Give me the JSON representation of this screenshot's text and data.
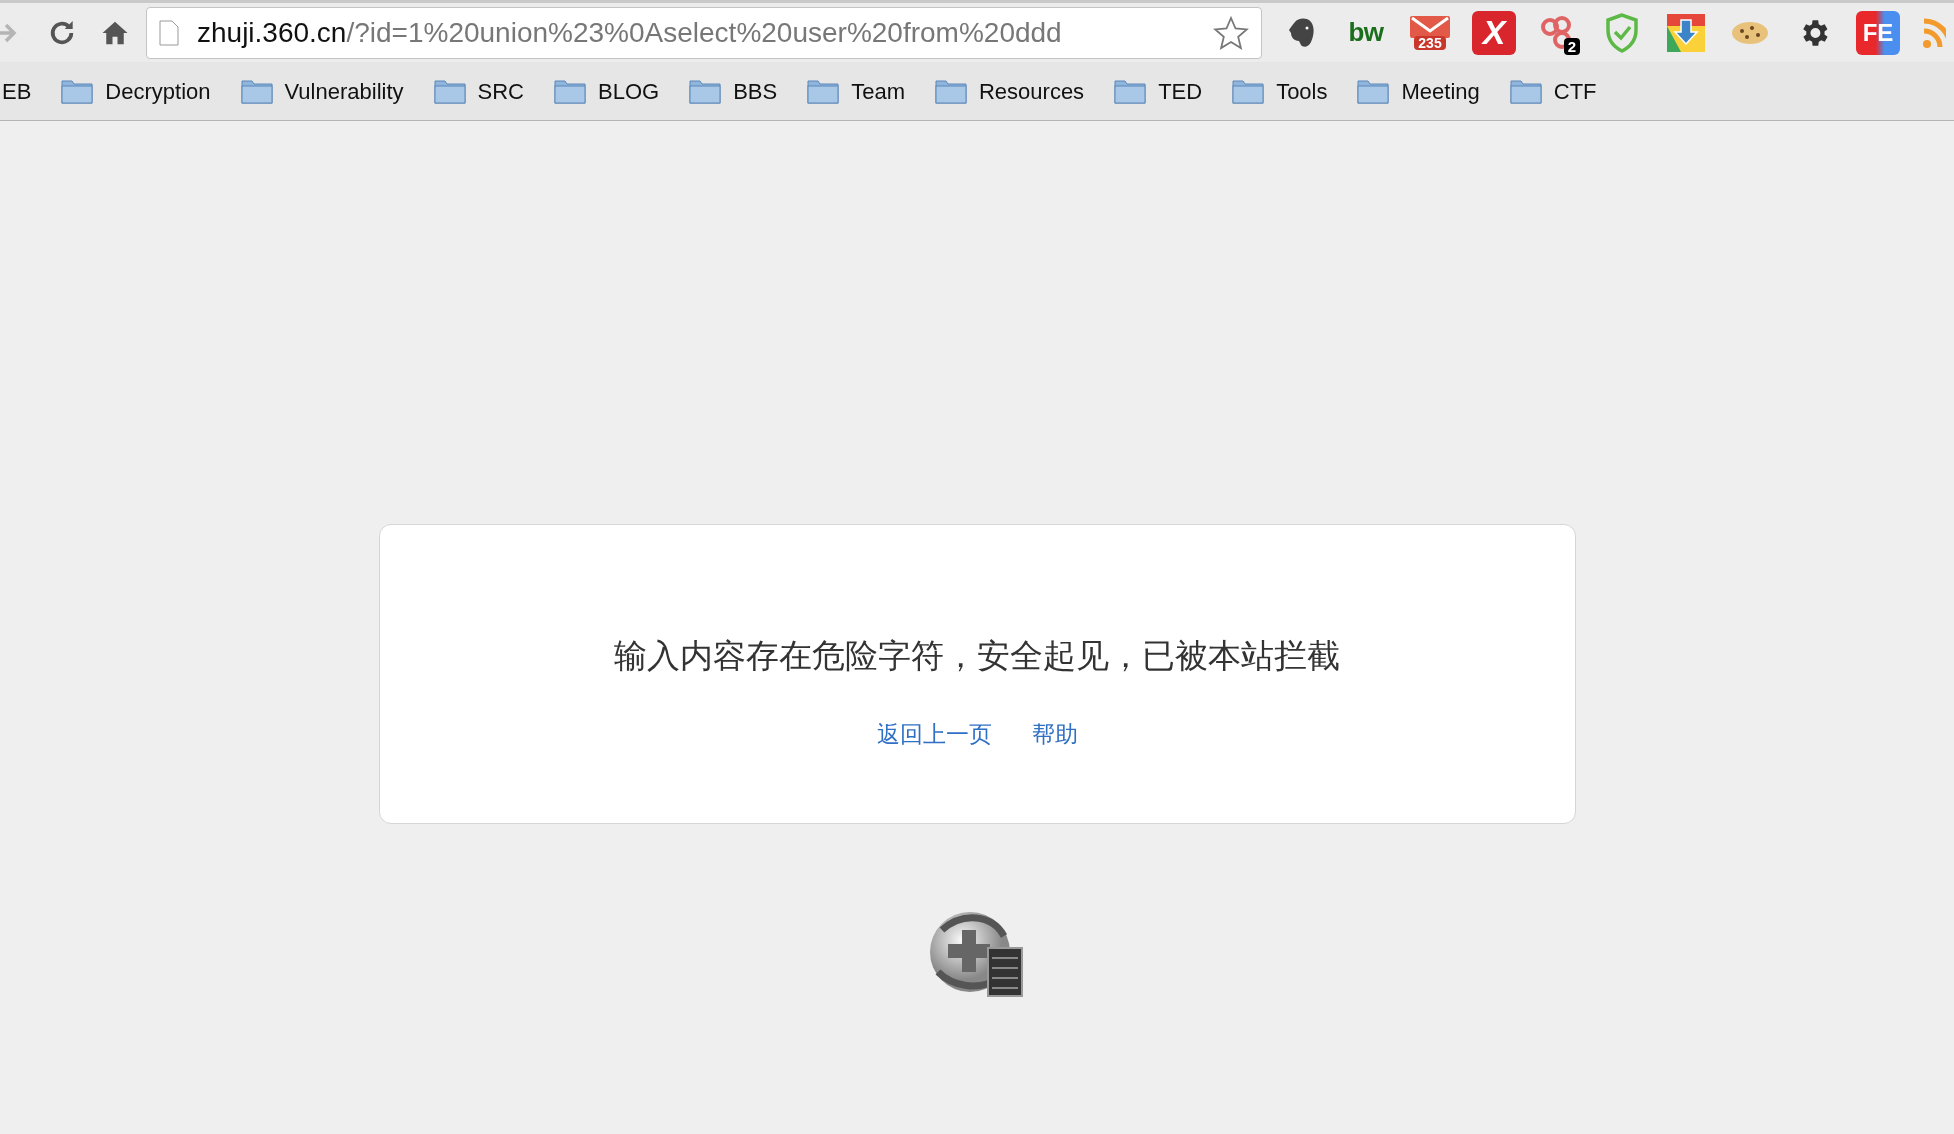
{
  "address_bar": {
    "host": "zhuji.360.cn",
    "path": "/?id=1%20union%23%0Aselect%20user%20from%20ddd"
  },
  "extensions": [
    {
      "kind": "elephant"
    },
    {
      "kind": "text",
      "label": "bw"
    },
    {
      "kind": "mail",
      "badge": "235"
    },
    {
      "kind": "x",
      "label": "X"
    },
    {
      "kind": "circles",
      "badge": "2"
    },
    {
      "kind": "shield"
    },
    {
      "kind": "download"
    },
    {
      "kind": "cookie"
    },
    {
      "kind": "gear"
    },
    {
      "kind": "fe",
      "label": "FE"
    },
    {
      "kind": "rss"
    }
  ],
  "bookmarks_edge_text": "EB",
  "bookmarks": [
    "Decryption",
    "Vulnerability",
    "SRC",
    "BLOG",
    "BBS",
    "Team",
    "Resources",
    "TED",
    "Tools",
    "Meeting",
    "CTF"
  ],
  "notice": {
    "message": "输入内容存在危险字符，安全起见，已被本站拦截",
    "links": [
      "返回上一页",
      "帮助"
    ]
  }
}
